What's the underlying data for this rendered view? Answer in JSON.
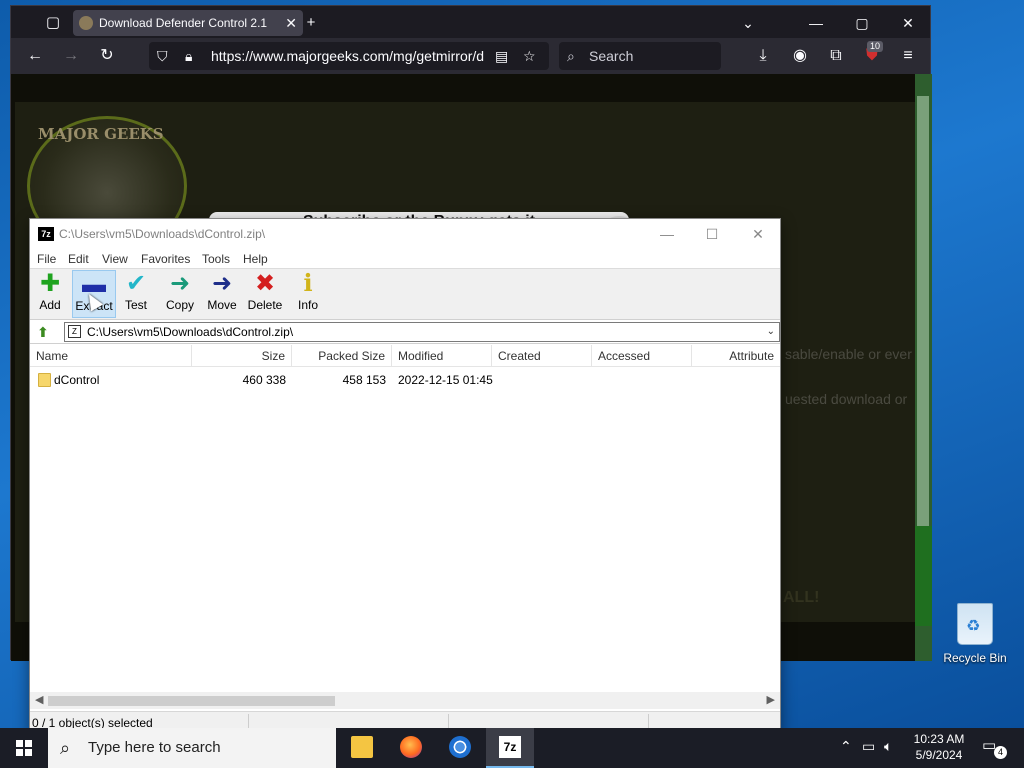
{
  "browser": {
    "tab_title": "Download Defender Control 2.1",
    "url": "https://www.majorgeeks.com/mg/getmirror/d",
    "search_placeholder": "Search",
    "extensions_badge": "10",
    "page": {
      "logo_text": "MAJOR GEEKS",
      "popup_title": "Subscribe or the Bunny gets it",
      "popup_close": "X",
      "bg_text_1": "sable/enable or ever",
      "bg_text_2": "uested download or",
      "bg_text_3": "ALL!"
    }
  },
  "sevenzip": {
    "title": "C:\\Users\\vm5\\Downloads\\dControl.zip\\",
    "icon_text": "7z",
    "menu": [
      "File",
      "Edit",
      "View",
      "Favorites",
      "Tools",
      "Help"
    ],
    "toolbar": [
      {
        "label": "Add",
        "icon": "plus-icon",
        "color": "#1fa31f"
      },
      {
        "label": "Extract",
        "icon": "minus-icon",
        "color": "#1f2fa8"
      },
      {
        "label": "Test",
        "icon": "check-icon",
        "color": "#23b6c9"
      },
      {
        "label": "Copy",
        "icon": "arrow-right-icon",
        "color": "#1a9a7a"
      },
      {
        "label": "Move",
        "icon": "arrow-right-icon",
        "color": "#1f2f8a"
      },
      {
        "label": "Delete",
        "icon": "x-icon",
        "color": "#d41f1f"
      },
      {
        "label": "Info",
        "icon": "info-icon",
        "color": "#d1b41a"
      }
    ],
    "address": "C:\\Users\\vm5\\Downloads\\dControl.zip\\",
    "columns": [
      "Name",
      "Size",
      "Packed Size",
      "Modified",
      "Created",
      "Accessed",
      "Attribute"
    ],
    "rows": [
      {
        "name": "dControl",
        "size": "460 338",
        "packed": "458 153",
        "modified": "2022-12-15 01:45",
        "created": "",
        "accessed": "",
        "attributes": ""
      }
    ],
    "status": "0 / 1 object(s) selected"
  },
  "desktop": {
    "recycle_bin_label": "Recycle Bin"
  },
  "taskbar": {
    "search_placeholder": "Type here to search",
    "time": "10:23 AM",
    "date": "5/9/2024",
    "notification_count": "4"
  }
}
